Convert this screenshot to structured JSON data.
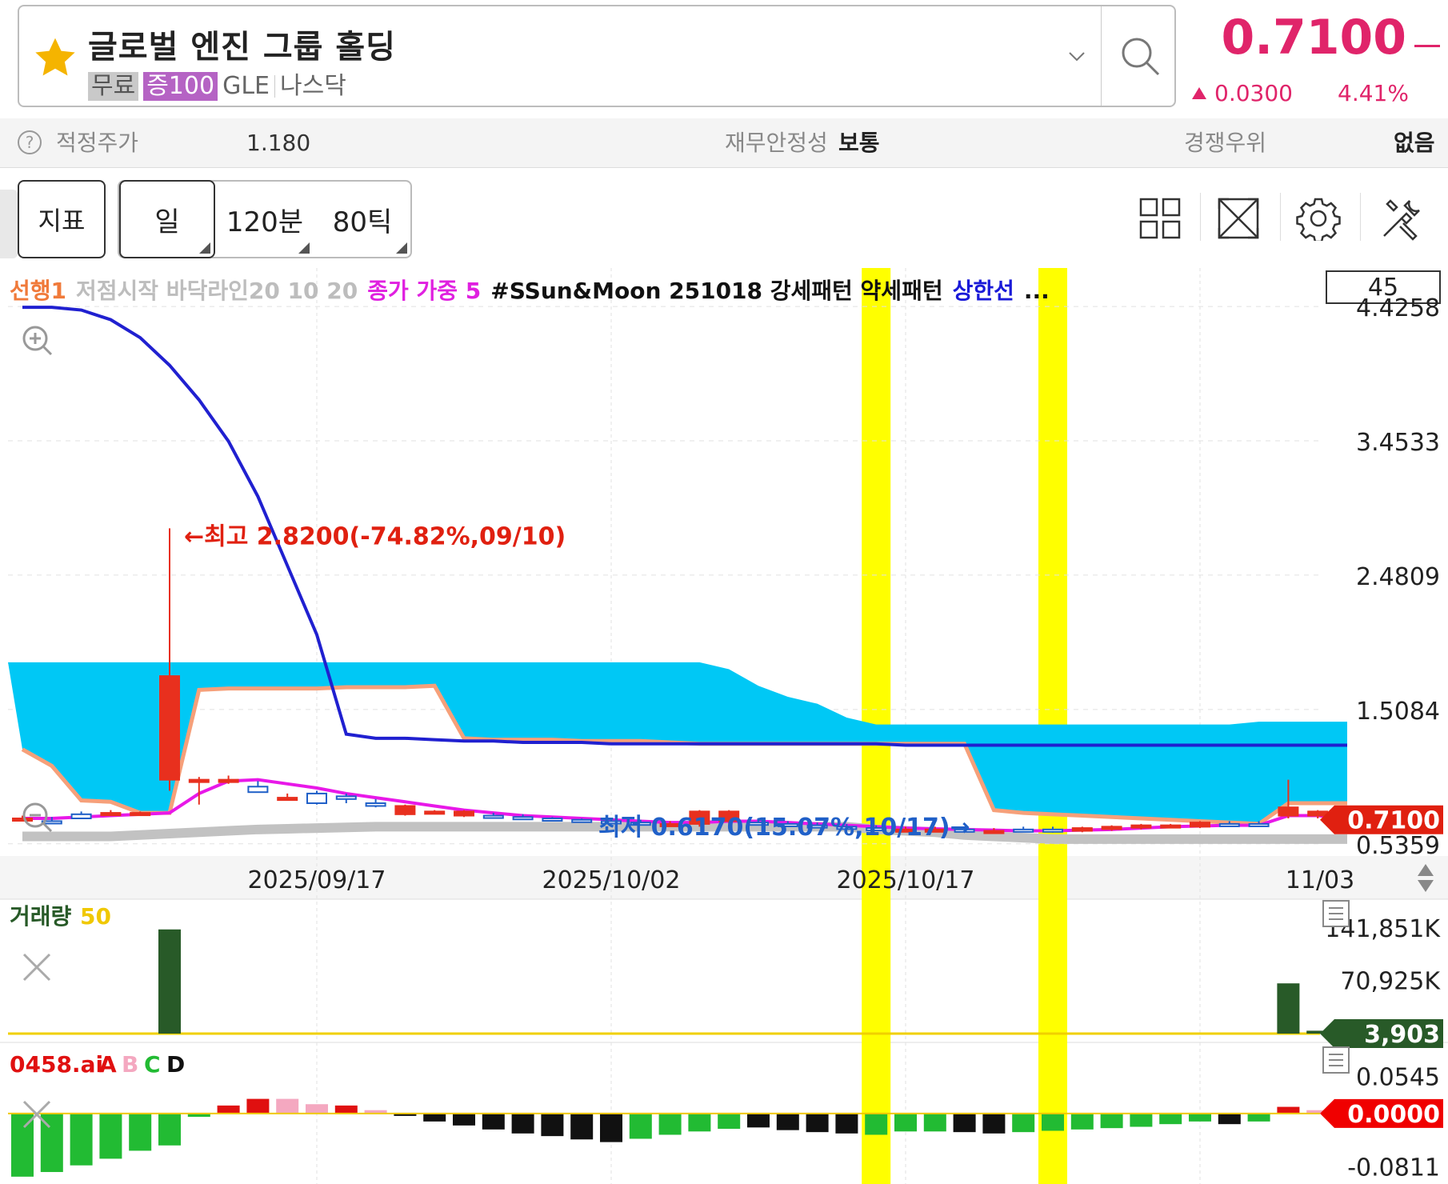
{
  "header": {
    "stock_name": "글로벌 엔진 그룹 홀딩",
    "tags": [
      "무료",
      "증100",
      "GLE",
      "나스닥"
    ],
    "price": "0.7100",
    "change": "0.0300",
    "change_pct": "4.41%",
    "up_color": "#e0246a"
  },
  "infobar": {
    "fair_price_label": "적정주가",
    "fair_price_value": "1.180",
    "stability_label": "재무안정성",
    "stability_value": "보통",
    "competitive_label": "경쟁우위",
    "competitive_value": "없음"
  },
  "toolbar": {
    "indicator_label": "지표",
    "periods": [
      "일",
      "120분",
      "80틱"
    ],
    "icons": [
      "layout-grid-icon",
      "fullscreen-icon",
      "settings-gear-icon",
      "tools-icon"
    ]
  },
  "chart_data": [
    {
      "type": "candlestick",
      "indicators_legend": [
        {
          "text": "선행1",
          "color": "#f07a3a"
        },
        {
          "text": "저점시작 바닥라인20 10 20",
          "color": "#bdbdbd"
        },
        {
          "text": "종가 가중 5",
          "color": "#e020e0"
        },
        {
          "text": "#SSun&Moon 251018 강세패턴 약세패턴",
          "color": "#111111"
        },
        {
          "text": "상한선",
          "color": "#1a1ad8"
        },
        {
          "text": "...",
          "color": "#111111"
        }
      ],
      "count_box": "45",
      "y_ticks": [
        "4.4258",
        "3.4533",
        "2.4809",
        "1.5084",
        "0.5359"
      ],
      "ylim": [
        0.45,
        4.6
      ],
      "x_labels": [
        "2025/09/17",
        "2025/10/02",
        "2025/10/17",
        "11/03"
      ],
      "current_price_label": "0.7100",
      "annotations": {
        "high": "←최고 2.8200(-74.82%,09/10)",
        "low": "최저 0.6170(15.07%,10/17)→"
      },
      "highlight_bars": [
        29,
        35
      ],
      "candles": [
        {
          "o": 0.72,
          "h": 0.74,
          "l": 0.7,
          "c": 0.72
        },
        {
          "o": 0.7,
          "h": 0.73,
          "l": 0.68,
          "c": 0.69
        },
        {
          "o": 0.75,
          "h": 0.77,
          "l": 0.72,
          "c": 0.72
        },
        {
          "o": 0.76,
          "h": 0.78,
          "l": 0.74,
          "c": 0.76
        },
        {
          "o": 0.76,
          "h": 0.77,
          "l": 0.75,
          "c": 0.76
        },
        {
          "o": 1.0,
          "h": 2.82,
          "l": 0.92,
          "c": 1.75
        },
        {
          "o": 1.0,
          "h": 1.02,
          "l": 0.82,
          "c": 1.0
        },
        {
          "o": 1.0,
          "h": 1.03,
          "l": 0.97,
          "c": 1.0
        },
        {
          "o": 0.95,
          "h": 0.99,
          "l": 0.91,
          "c": 0.91
        },
        {
          "o": 0.87,
          "h": 0.9,
          "l": 0.86,
          "c": 0.87
        },
        {
          "o": 0.9,
          "h": 0.92,
          "l": 0.82,
          "c": 0.83
        },
        {
          "o": 0.88,
          "h": 0.9,
          "l": 0.83,
          "c": 0.86
        },
        {
          "o": 0.83,
          "h": 0.86,
          "l": 0.8,
          "c": 0.81
        },
        {
          "o": 0.75,
          "h": 0.82,
          "l": 0.74,
          "c": 0.81
        },
        {
          "o": 0.77,
          "h": 0.78,
          "l": 0.75,
          "c": 0.77
        },
        {
          "o": 0.74,
          "h": 0.78,
          "l": 0.73,
          "c": 0.77
        },
        {
          "o": 0.74,
          "h": 0.76,
          "l": 0.72,
          "c": 0.73
        },
        {
          "o": 0.73,
          "h": 0.75,
          "l": 0.71,
          "c": 0.72
        },
        {
          "o": 0.72,
          "h": 0.73,
          "l": 0.7,
          "c": 0.71
        },
        {
          "o": 0.71,
          "h": 0.72,
          "l": 0.69,
          "c": 0.7
        },
        {
          "o": 0.7,
          "h": 0.72,
          "l": 0.68,
          "c": 0.69
        },
        {
          "o": 0.69,
          "h": 0.71,
          "l": 0.67,
          "c": 0.68
        },
        {
          "o": 0.68,
          "h": 0.7,
          "l": 0.66,
          "c": 0.68
        },
        {
          "o": 0.68,
          "h": 0.78,
          "l": 0.66,
          "c": 0.77
        },
        {
          "o": 0.7,
          "h": 0.78,
          "l": 0.68,
          "c": 0.77
        },
        {
          "o": 0.69,
          "h": 0.71,
          "l": 0.67,
          "c": 0.68
        },
        {
          "o": 0.68,
          "h": 0.7,
          "l": 0.66,
          "c": 0.67
        },
        {
          "o": 0.67,
          "h": 0.69,
          "l": 0.65,
          "c": 0.66
        },
        {
          "o": 0.66,
          "h": 0.68,
          "l": 0.64,
          "c": 0.65
        },
        {
          "o": 0.65,
          "h": 0.67,
          "l": 0.63,
          "c": 0.64
        },
        {
          "o": 0.64,
          "h": 0.66,
          "l": 0.62,
          "c": 0.64
        },
        {
          "o": 0.64,
          "h": 0.66,
          "l": 0.62,
          "c": 0.64
        },
        {
          "o": 0.64,
          "h": 0.66,
          "l": 0.62,
          "c": 0.63
        },
        {
          "o": 0.63,
          "h": 0.65,
          "l": 0.62,
          "c": 0.63
        },
        {
          "o": 0.64,
          "h": 0.66,
          "l": 0.62,
          "c": 0.63
        },
        {
          "o": 0.64,
          "h": 0.66,
          "l": 0.617,
          "c": 0.63
        },
        {
          "o": 0.63,
          "h": 0.66,
          "l": 0.62,
          "c": 0.65
        },
        {
          "o": 0.65,
          "h": 0.67,
          "l": 0.63,
          "c": 0.66
        },
        {
          "o": 0.66,
          "h": 0.68,
          "l": 0.64,
          "c": 0.67
        },
        {
          "o": 0.66,
          "h": 0.68,
          "l": 0.65,
          "c": 0.67
        },
        {
          "o": 0.66,
          "h": 0.7,
          "l": 0.65,
          "c": 0.69
        },
        {
          "o": 0.68,
          "h": 0.7,
          "l": 0.66,
          "c": 0.67
        },
        {
          "o": 0.68,
          "h": 0.7,
          "l": 0.66,
          "c": 0.67
        },
        {
          "o": 0.74,
          "h": 1.0,
          "l": 0.72,
          "c": 0.8
        },
        {
          "o": 0.74,
          "h": 0.78,
          "l": 0.72,
          "c": 0.77
        },
        {
          "o": 0.71,
          "h": 0.73,
          "l": 0.69,
          "c": 0.71
        }
      ],
      "cloud_top": [
        1.85,
        1.85,
        1.85,
        1.85,
        1.85,
        1.85,
        1.85,
        1.85,
        1.85,
        1.85,
        1.85,
        1.85,
        1.85,
        1.85,
        1.85,
        1.85,
        1.85,
        1.85,
        1.85,
        1.85,
        1.85,
        1.85,
        1.85,
        1.85,
        1.8,
        1.68,
        1.6,
        1.55,
        1.45,
        1.4,
        1.4,
        1.4,
        1.4,
        1.4,
        1.4,
        1.4,
        1.4,
        1.4,
        1.4,
        1.4,
        1.4,
        1.4,
        1.42,
        1.42,
        1.42,
        1.42
      ],
      "cloud_bottom": [
        1.22,
        1.1,
        0.85,
        0.84,
        0.76,
        0.76,
        1.65,
        1.66,
        1.66,
        1.66,
        1.66,
        1.67,
        1.67,
        1.67,
        1.68,
        1.3,
        1.29,
        1.29,
        1.29,
        1.28,
        1.28,
        1.28,
        1.27,
        1.26,
        1.26,
        1.26,
        1.26,
        1.26,
        1.26,
        1.26,
        1.26,
        1.26,
        1.26,
        0.78,
        0.76,
        0.75,
        0.74,
        0.73,
        0.72,
        0.71,
        0.7,
        0.69,
        0.68,
        0.83,
        0.83,
        0.83
      ],
      "upper_line": [
        4.42,
        4.42,
        4.4,
        4.33,
        4.2,
        4.0,
        3.75,
        3.45,
        3.05,
        2.55,
        2.05,
        1.33,
        1.3,
        1.3,
        1.29,
        1.28,
        1.28,
        1.27,
        1.27,
        1.27,
        1.26,
        1.26,
        1.26,
        1.26,
        1.26,
        1.26,
        1.26,
        1.26,
        1.26,
        1.26,
        1.25,
        1.25,
        1.25,
        1.25,
        1.25,
        1.25,
        1.25,
        1.25,
        1.25,
        1.25,
        1.25,
        1.25,
        1.25,
        1.25,
        1.25,
        1.25
      ],
      "wma5": [
        0.72,
        0.72,
        0.73,
        0.74,
        0.75,
        0.76,
        0.9,
        0.99,
        1.0,
        0.97,
        0.94,
        0.9,
        0.87,
        0.84,
        0.81,
        0.78,
        0.76,
        0.74,
        0.73,
        0.72,
        0.71,
        0.7,
        0.69,
        0.69,
        0.7,
        0.7,
        0.69,
        0.68,
        0.67,
        0.66,
        0.65,
        0.645,
        0.64,
        0.635,
        0.63,
        0.63,
        0.635,
        0.64,
        0.65,
        0.66,
        0.665,
        0.67,
        0.67,
        0.74,
        0.74,
        0.72
      ],
      "floor_line": [
        0.59,
        0.59,
        0.59,
        0.59,
        0.6,
        0.61,
        0.62,
        0.63,
        0.64,
        0.645,
        0.65,
        0.655,
        0.66,
        0.66,
        0.66,
        0.66,
        0.66,
        0.66,
        0.66,
        0.66,
        0.66,
        0.66,
        0.66,
        0.66,
        0.66,
        0.66,
        0.66,
        0.66,
        0.66,
        0.64,
        0.63,
        0.62,
        0.6,
        0.59,
        0.58,
        0.57,
        0.57,
        0.57,
        0.57,
        0.57,
        0.57,
        0.57,
        0.57,
        0.57,
        0.57,
        0.57
      ]
    },
    {
      "type": "bar",
      "title": "거래량",
      "title_param": "50",
      "y_ticks": [
        "141,851K",
        "70,925K"
      ],
      "ylim": [
        0,
        141851
      ],
      "current_label": "3,903",
      "values": [
        300,
        300,
        300,
        300,
        300,
        141000,
        300,
        300,
        300,
        300,
        300,
        300,
        300,
        300,
        300,
        300,
        300,
        300,
        300,
        300,
        300,
        300,
        300,
        300,
        300,
        300,
        300,
        300,
        300,
        300,
        300,
        300,
        300,
        300,
        300,
        300,
        300,
        300,
        300,
        300,
        300,
        300,
        300,
        68000,
        3903,
        3903
      ]
    },
    {
      "type": "bar",
      "title": "0458.ai",
      "legend": [
        {
          "text": "A",
          "color": "#e01010"
        },
        {
          "text": "B",
          "color": "#f4a8c0"
        },
        {
          "text": "C",
          "color": "#22bb33"
        },
        {
          "text": "D",
          "color": "#111111"
        }
      ],
      "y_ticks": [
        "0.0545",
        "-0.0811"
      ],
      "ylim": [
        -0.1,
        0.06
      ],
      "current_label": "0.0000",
      "values": [
        -0.095,
        -0.088,
        -0.078,
        -0.068,
        -0.056,
        -0.048,
        -0.005,
        0.012,
        0.022,
        0.022,
        0.014,
        0.012,
        0.005,
        -0.001,
        -0.012,
        -0.018,
        -0.024,
        -0.03,
        -0.034,
        -0.039,
        -0.043,
        -0.038,
        -0.032,
        -0.027,
        -0.023,
        -0.021,
        -0.025,
        -0.028,
        -0.03,
        -0.032,
        -0.027,
        -0.027,
        -0.028,
        -0.03,
        -0.028,
        -0.026,
        -0.024,
        -0.022,
        -0.02,
        -0.016,
        -0.012,
        -0.016,
        -0.012,
        0.01,
        0.005,
        0.005
      ],
      "colors": [
        "C",
        "C",
        "C",
        "C",
        "C",
        "C",
        "C",
        "A",
        "A",
        "B",
        "B",
        "A",
        "B",
        "D",
        "D",
        "D",
        "D",
        "D",
        "D",
        "D",
        "D",
        "C",
        "C",
        "C",
        "C",
        "D",
        "D",
        "D",
        "D",
        "C",
        "C",
        "C",
        "D",
        "D",
        "C",
        "C",
        "C",
        "C",
        "C",
        "C",
        "C",
        "D",
        "C",
        "A",
        "B",
        "B"
      ]
    }
  ]
}
